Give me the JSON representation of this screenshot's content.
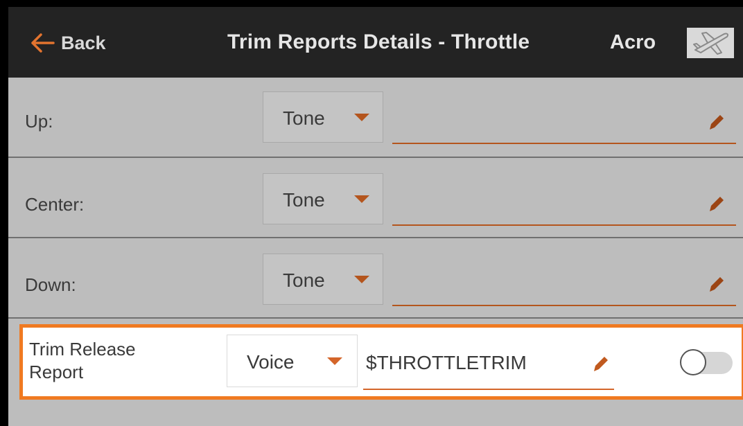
{
  "header": {
    "back_label": "Back",
    "title": "Trim Reports Details - Throttle",
    "model_type": "Acro",
    "model_icon": "airplane-icon"
  },
  "rows": [
    {
      "label": "Up:",
      "mode": "Tone",
      "value": ""
    },
    {
      "label": "Center:",
      "mode": "Tone",
      "value": ""
    },
    {
      "label": "Down:",
      "mode": "Tone",
      "value": ""
    }
  ],
  "release_row": {
    "label_line1": "Trim Release",
    "label_line2": "Report",
    "mode": "Voice",
    "value": "$THROTTLETRIM",
    "toggle_on": false
  },
  "colors": {
    "accent": "#b4551d",
    "highlight_border": "#f07a21",
    "header_bg": "#232323"
  }
}
